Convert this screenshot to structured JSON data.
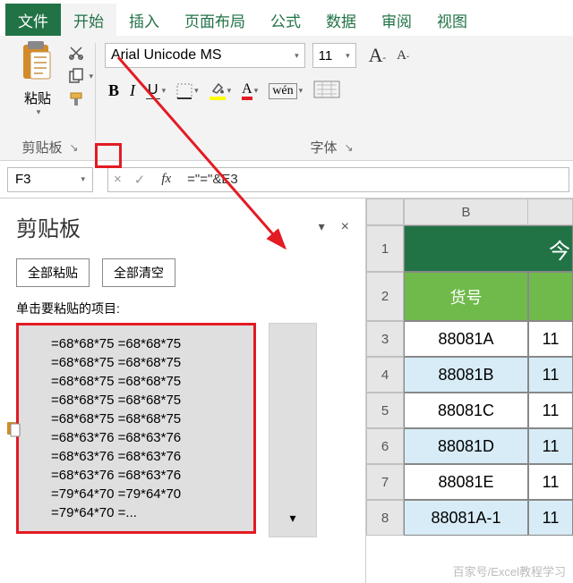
{
  "tabs": {
    "file": "文件",
    "home": "开始",
    "insert": "插入",
    "layout": "页面布局",
    "formulas": "公式",
    "data": "数据",
    "review": "审阅",
    "view": "视图"
  },
  "ribbon": {
    "paste_label": "粘贴",
    "clipboard_group": "剪贴板",
    "font_group": "字体",
    "font_name": "Arial Unicode MS",
    "font_size": "11",
    "bold": "B",
    "italic": "I",
    "underline": "U",
    "wen": "wén",
    "a_big_label": "A",
    "a_small_label": "A"
  },
  "formula_bar": {
    "cell_ref": "F3",
    "fx": "fx",
    "formula": "=\"=\"&E3",
    "cancel": "×",
    "confirm": "✓"
  },
  "pane": {
    "title": "剪贴板",
    "paste_all": "全部粘贴",
    "clear_all": "全部清空",
    "subtitle": "单击要粘贴的项目:",
    "scroll_arrow": "▾",
    "lines": [
      "=68*68*75 =68*68*75",
      "=68*68*75 =68*68*75",
      "=68*68*75 =68*68*75",
      "=68*68*75 =68*68*75",
      "=68*68*75 =68*68*75",
      "=68*63*76 =68*63*76",
      "=68*63*76 =68*63*76",
      "=68*63*76 =68*63*76",
      "=79*64*70 =79*64*70",
      "=79*64*70 =..."
    ]
  },
  "sheet": {
    "col_b": "B",
    "title_cell": "今",
    "header_b": "货号",
    "rows": [
      {
        "n": "3",
        "b": "88081A",
        "c": "11"
      },
      {
        "n": "4",
        "b": "88081B",
        "c": "11"
      },
      {
        "n": "5",
        "b": "88081C",
        "c": "11"
      },
      {
        "n": "6",
        "b": "88081D",
        "c": "11"
      },
      {
        "n": "7",
        "b": "88081E",
        "c": "11"
      },
      {
        "n": "8",
        "b": "88081A-1",
        "c": "11"
      }
    ]
  },
  "watermark": "百家号/Excel教程学习"
}
